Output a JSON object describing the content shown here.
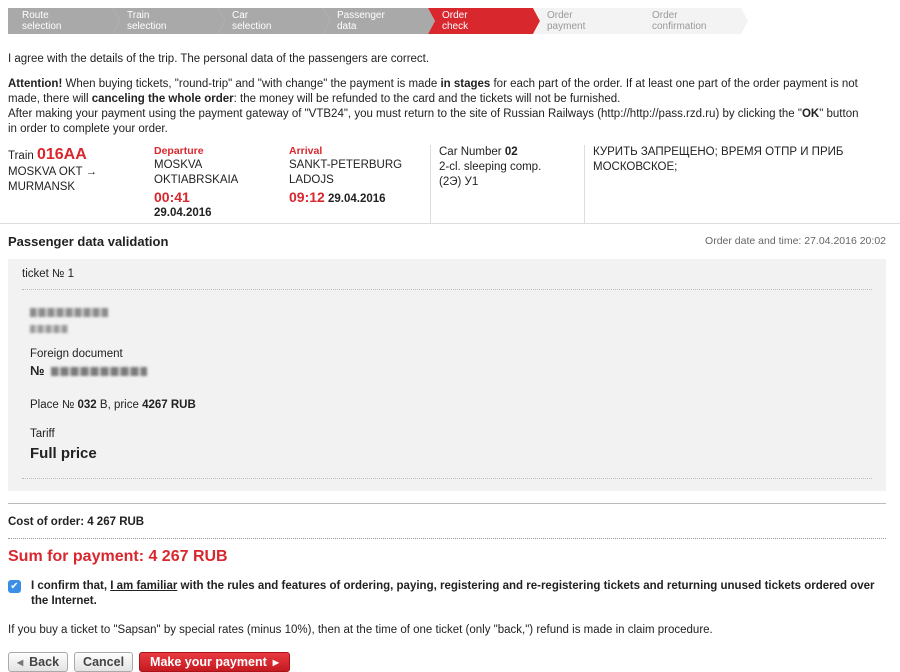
{
  "steps": [
    {
      "line1": "Route",
      "line2": "selection",
      "state": "done"
    },
    {
      "line1": "Train",
      "line2": "selection",
      "state": "done"
    },
    {
      "line1": "Car",
      "line2": "selection",
      "state": "done"
    },
    {
      "line1": "Passenger",
      "line2": "data",
      "state": "done"
    },
    {
      "line1": "Order",
      "line2": "check",
      "state": "active"
    },
    {
      "line1": "Order",
      "line2": "payment",
      "state": "todo"
    },
    {
      "line1": "Order",
      "line2": "confirmation",
      "state": "todo"
    }
  ],
  "agree_text": "I agree with the details of the trip. The personal data of the passengers are correct.",
  "attention": {
    "label": "Attention!",
    "t1": " When buying tickets, \"round-trip\" and \"with change\" the payment is made ",
    "b1": "in stages",
    "t2": " for each part of the order. If at least one part of the order payment is not made, there will ",
    "b2": "canceling the whole order",
    "t3": ": the money will be refunded to the card and the tickets will not be furnished.",
    "t4": "After making your payment using the payment gateway of \"VTB24\", you must return to the site of Russian Railways (http://http://pass.rzd.ru) by clicking the \"",
    "b3": "OK",
    "t5": "\" button in order to complete your order."
  },
  "trip": {
    "train_label": "Train",
    "train_no": "016AA",
    "route": "MOSKVA OKT → MURMANSK",
    "departure_label": "Departure",
    "departure_station": "MOSKVA OKTIABRSKAIA",
    "departure_time": "00:41",
    "departure_date": "29.04.2016",
    "arrival_label": "Arrival",
    "arrival_station": "SANKT-PETERBURG LADOJS",
    "arrival_time": "09:12",
    "arrival_date": "29.04.2016",
    "car_label": "Car Number",
    "car_no": "02",
    "car_class": "2-cl. sleeping comp.",
    "car_service": "(2Э) У1",
    "notes": "КУРИТЬ ЗАПРЕЩЕНО; ВРЕМЯ ОТПР И ПРИБ МОСКОВСКОЕ;"
  },
  "validation": {
    "title": "Passenger data validation",
    "order_date": "Order date and time: 27.04.2016 20:02"
  },
  "ticket": {
    "title": "ticket № 1",
    "doc_label": "Foreign document",
    "doc_no_prefix": "№",
    "place_prefix": "Place №",
    "place_no": "032",
    "place_mid": " В, price ",
    "price": "4267 RUB",
    "tariff_label": "Tariff",
    "tariff_value": "Full price"
  },
  "cost_text": "Cost of order: 4 267 RUB",
  "sum_text": "Sum for payment: 4 267 RUB",
  "confirm": {
    "checked": true,
    "t1": "I confirm that, ",
    "link": "I am familiar",
    "t2": " with the rules and features of ordering, paying, registering and re-registering tickets and returning unused tickets ordered over the Internet."
  },
  "sapsan_text": "If you buy a ticket to \"Sapsan\" by special rates (minus 10%), then at the time of one ticket (only \"back,\") refund is made in claim procedure.",
  "buttons": {
    "back": "Back",
    "cancel": "Cancel",
    "pay": "Make your payment"
  }
}
